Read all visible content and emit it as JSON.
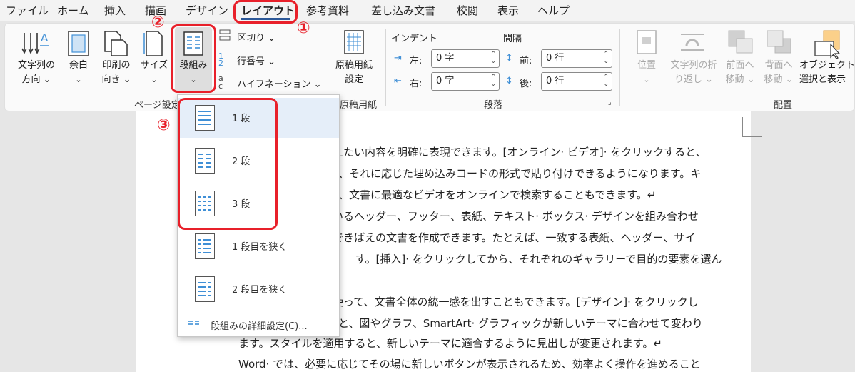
{
  "tabs": [
    "ファイル",
    "ホーム",
    "挿入",
    "描画",
    "デザイン",
    "レイアウト",
    "参考資料",
    "差し込み文書",
    "校閲",
    "表示",
    "ヘルプ"
  ],
  "active_tab": "レイアウト",
  "page_setup": {
    "text_direction": [
      "文字列の",
      "方向 ⌄"
    ],
    "margins": [
      "余白",
      "⌄"
    ],
    "orientation": [
      "印刷の",
      "向き ⌄"
    ],
    "size": [
      "サイズ",
      "⌄"
    ],
    "columns": [
      "段組み",
      "⌄"
    ],
    "breaks": "区切り ⌄",
    "line_numbers": "行番号 ⌄",
    "hyphenation": "ハイフネーション ⌄",
    "group_label": "ページ設定"
  },
  "manuscript": {
    "button": [
      "原稿用紙",
      "設定"
    ],
    "group_label": "原稿用紙"
  },
  "paragraph": {
    "indent_header": "インデント",
    "spacing_header": "間隔",
    "left_label": "左:",
    "left_value": "0 字",
    "right_label": "右:",
    "right_value": "0 字",
    "before_label": "前:",
    "before_value": "0 行",
    "after_label": "後:",
    "after_value": "0 行",
    "group_label": "段落"
  },
  "arrange": {
    "position": [
      "位置",
      "⌄"
    ],
    "wrap_text": [
      "文字列の折",
      "り返し ⌄"
    ],
    "bring_forward": [
      "前面へ",
      "移動 ⌄"
    ],
    "send_backward": [
      "背面へ",
      "移動 ⌄"
    ],
    "selection_pane": [
      "オブジェクトの",
      "選択と表示"
    ],
    "group_label": "配置"
  },
  "columns_menu": {
    "items": [
      "1 段",
      "2 段",
      "3 段",
      "1 段目を狭く",
      "2 段目を狭く"
    ],
    "more": "段組みの詳細設定(C)..."
  },
  "annotations": [
    "①",
    "②",
    "③"
  ],
  "document_lines": [
    "えたい内容を明確に表現できます。[オンライン· ビデオ]· をクリックすると、",
    "、それに応じた埋め込みコードの形式で貼り付けできるようになります。キ",
    "、文書に最適なビデオをオンラインで検索することもできます。↵",
    "いるヘッダー、フッター、表紙、テキスト· ボックス· デザインを組み合わせ",
    "できばえの文書を作成できます。たとえば、一致する表紙、ヘッダー、サイ",
    "す。[挿入]· をクリックしてから、それぞれのギャラリーで目的の要素を選ん",
    "",
    "使って、文書全体の統一感を出すこともできます。[デザイン]· をクリックし",
    "と、図やグラフ、SmartArt· グラフィックが新しいテーマに合わせて変わり",
    "ます。スタイルを適用すると、新しいテーマに適合するように見出しが変更されます。↵",
    "Word· では、必要に応じてその場に新しいボタンが表示されるため、効率よく操作を進めること"
  ],
  "colors": {
    "accent": "#2b5797",
    "annotation": "#e8202a",
    "menu_selected": "#e5eef9",
    "icon_blue": "#3f8fd6"
  }
}
